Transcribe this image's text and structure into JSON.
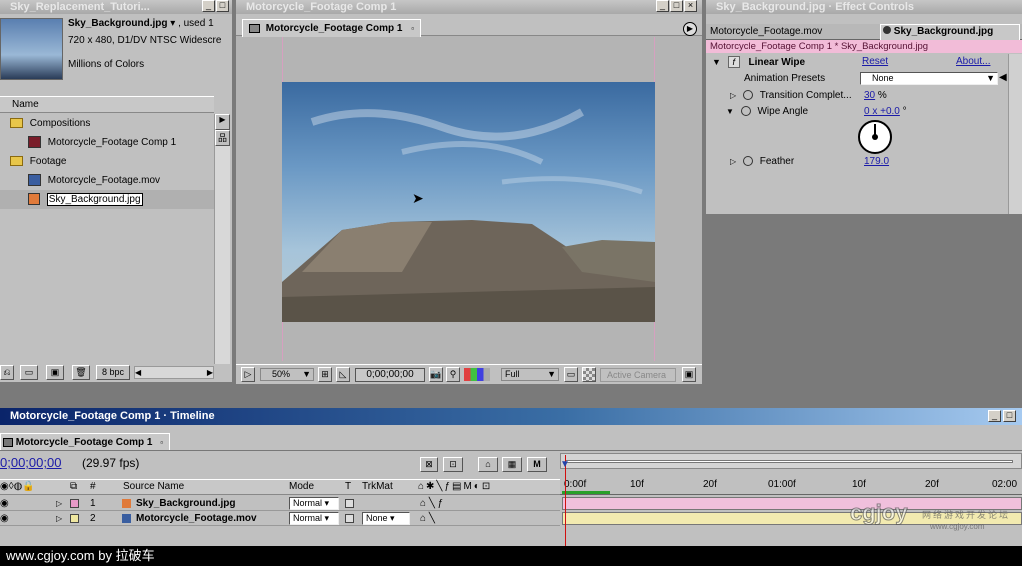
{
  "project": {
    "window_title": "Sky_Replacement_Tutori...",
    "asset_name": "Sky_Background.jpg",
    "used_label": ", used 1",
    "asset_size": "720 x 480, D1/DV NTSC Widescre",
    "asset_colors": "Millions of Colors",
    "col_name": "Name",
    "items": [
      {
        "label": "Compositions",
        "type": "folder"
      },
      {
        "label": "Motorcycle_Footage Comp 1",
        "type": "comp"
      },
      {
        "label": "Footage",
        "type": "folder"
      },
      {
        "label": "Motorcycle_Footage.mov",
        "type": "movie"
      },
      {
        "label": "Sky_Background.jpg",
        "type": "image"
      }
    ],
    "bpc": "8 bpc"
  },
  "comp": {
    "window_title": "Motorcycle_Footage Comp 1",
    "tab": "Motorcycle_Footage Comp 1",
    "zoom": "50%",
    "timecode": "0;00;00;00",
    "resolution": "Full",
    "camera": "Active Camera"
  },
  "effects": {
    "window_title": "Sky_Background.jpg · Effect Controls",
    "tab_inactive": "Motorcycle_Footage.mov",
    "tab_active": "Sky_Background.jpg",
    "subheader": "Motorcycle_Footage Comp 1 * Sky_Background.jpg",
    "effect_name": "Linear Wipe",
    "reset": "Reset",
    "about": "About...",
    "presets_label": "Animation Presets",
    "presets_value": "None",
    "params": [
      {
        "name": "Transition Complet...",
        "value": "30",
        "unit": "%"
      },
      {
        "name": "Wipe Angle",
        "value": "0 x +0.0",
        "unit": "°"
      },
      {
        "name": "Feather",
        "value": "179.0",
        "unit": ""
      }
    ]
  },
  "timeline": {
    "window_title": "Motorcycle_Footage Comp 1 · Timeline",
    "tab": "Motorcycle_Footage Comp 1",
    "timecode": "0;00;00;00",
    "fps": "(29.97 fps)",
    "col_num": "#",
    "col_source": "Source Name",
    "col_mode": "Mode",
    "col_t": "T",
    "col_trkmat": "TrkMat",
    "ruler": [
      "0:00f",
      "10f",
      "20f",
      "01:00f",
      "10f",
      "20f",
      "02:00"
    ],
    "layers": [
      {
        "num": "1",
        "name": "Sky_Background.jpg",
        "mode": "Normal",
        "trkmat": "",
        "color": "#e79ac8"
      },
      {
        "num": "2",
        "name": "Motorcycle_Footage.mov",
        "mode": "Normal",
        "trkmat": "None",
        "color": "#efe7a0"
      }
    ]
  },
  "watermark": {
    "footer": "www.cgjoy.com by 拉破车",
    "logo": "cgjoy",
    "logo_sub": "网络游戏开发论坛",
    "logo_url": "www.cgjoy.com"
  }
}
